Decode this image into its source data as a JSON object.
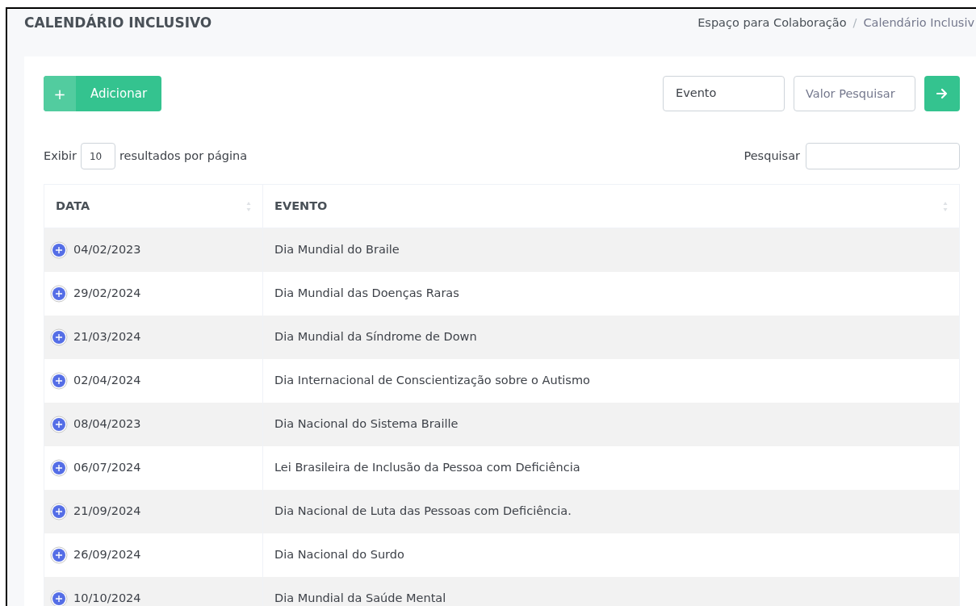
{
  "page_title": "CALENDÁRIO INCLUSIVO",
  "breadcrumb_separator": "/",
  "breadcrumb": [
    {
      "label": "Espaço para Colaboração",
      "selected": false
    },
    {
      "label": "Calendário Inclusiv",
      "selected": true
    }
  ],
  "toolbar": {
    "add_button": {
      "icon": "+",
      "label": "Adicionar"
    },
    "filter_field": {
      "value": "Evento"
    },
    "search_value_field": {
      "placeholder": "Valor Pesquisar"
    }
  },
  "length_control": {
    "prefix": "Exibir",
    "value": "10",
    "suffix": "resultados por página"
  },
  "search": {
    "label": "Pesquisar"
  },
  "table": {
    "columns": [
      "DATA",
      "EVENTO"
    ],
    "rows": [
      {
        "date": "04/02/2023",
        "event": "Dia Mundial do Braile"
      },
      {
        "date": "29/02/2024",
        "event": "Dia Mundial das Doenças Raras"
      },
      {
        "date": "21/03/2024",
        "event": "Dia Mundial da Síndrome de Down"
      },
      {
        "date": "02/04/2024",
        "event": "Dia Internacional de Conscientização sobre o Autismo"
      },
      {
        "date": "08/04/2023",
        "event": "Dia Nacional do Sistema Braille"
      },
      {
        "date": "06/07/2024",
        "event": "Lei Brasileira de Inclusão da Pessoa com Deficiência"
      },
      {
        "date": "21/09/2024",
        "event": "Dia Nacional de Luta das Pessoas com Deficiência."
      },
      {
        "date": "26/09/2024",
        "event": "Dia Nacional do Surdo"
      },
      {
        "date": "10/10/2024",
        "event": "Dia Mundial da Saúde Mental"
      }
    ]
  }
}
